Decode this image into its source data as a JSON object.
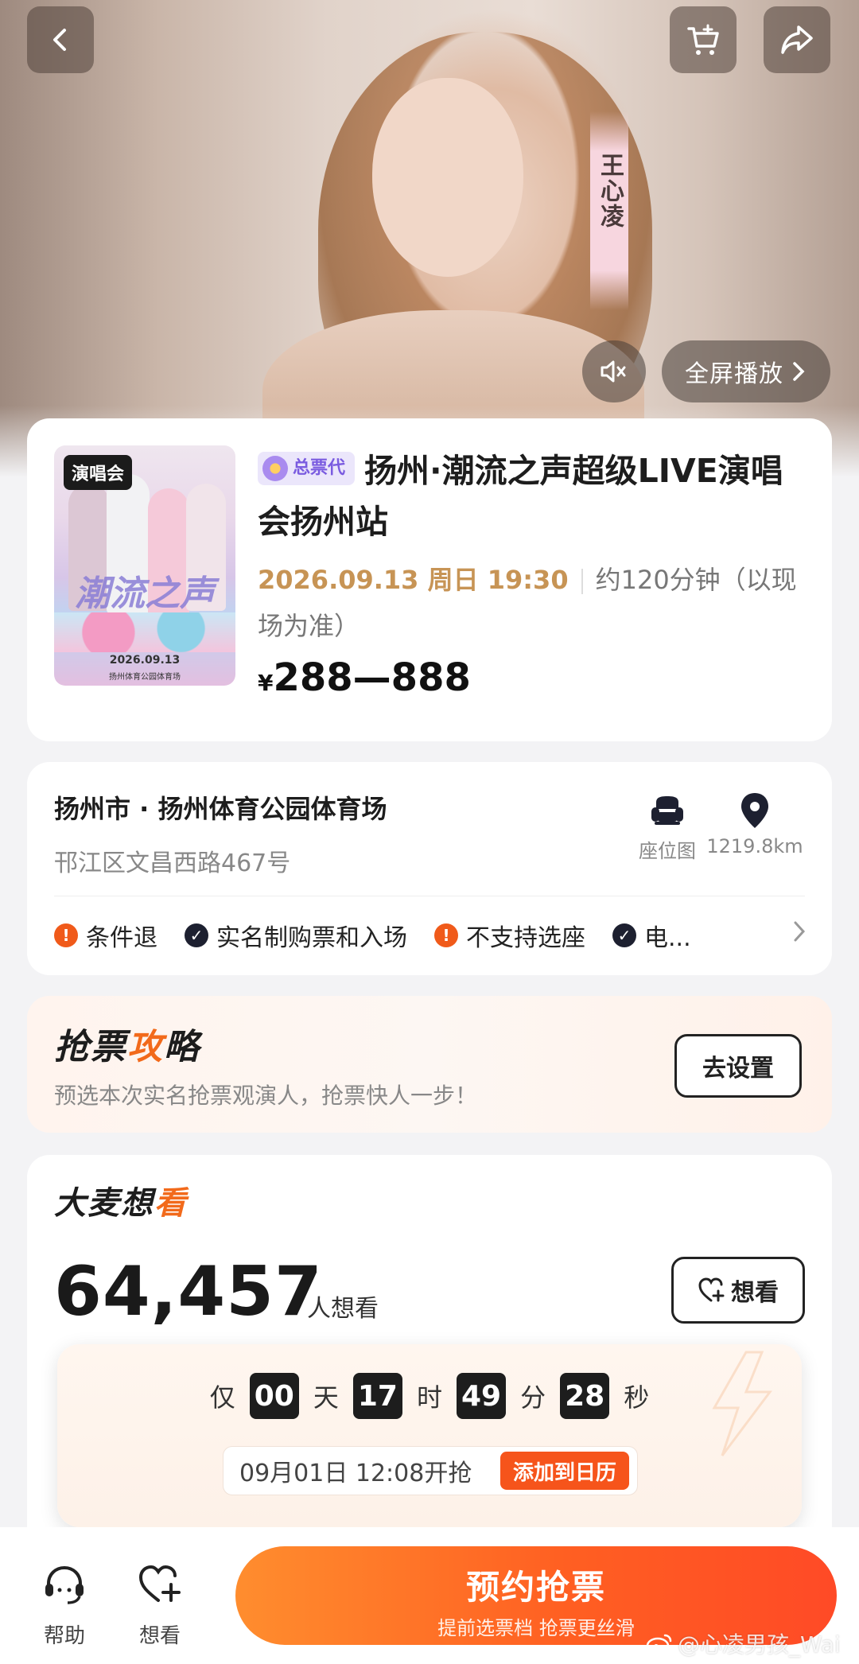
{
  "video": {
    "name_tag": "王心凌",
    "fullscreen_label": "全屏播放"
  },
  "event": {
    "poster_tag": "演唱会",
    "poster_title": "潮流之声",
    "poster_date": "2026.09.13",
    "poster_venue": "扬州体育公园体育场",
    "agent_badge": "总票代",
    "title": "扬州·潮流之声超级LIVE演唱会扬州站",
    "datetime": "2026.09.13 周日 19:30",
    "duration": "约120分钟（以现场为准）",
    "price_currency": "¥",
    "price_range": "288—888"
  },
  "venue": {
    "name": "扬州市 · 扬州体育公园体育场",
    "address": "邗江区文昌西路467号",
    "seat_map_label": "座位图",
    "distance": "1219.8km",
    "policies": [
      {
        "label": "条件退",
        "type": "warn"
      },
      {
        "label": "实名制购票和入场",
        "type": "ok"
      },
      {
        "label": "不支持选座",
        "type": "warn"
      },
      {
        "label": "电...",
        "type": "ok"
      }
    ]
  },
  "strategy": {
    "title_a": "抢票",
    "title_b": "攻",
    "title_c": "略",
    "subtitle": "预选本次实名抢票观演人，抢票快人一步！",
    "button": "去设置"
  },
  "want": {
    "title_a": "大麦想",
    "title_b": "看",
    "count": "64,457",
    "count_unit": "人想看",
    "button": "想看"
  },
  "countdown": {
    "prefix": "仅",
    "days": "00",
    "days_unit": "天",
    "hours": "17",
    "hours_unit": "时",
    "minutes": "49",
    "minutes_unit": "分",
    "seconds": "28",
    "seconds_unit": "秒",
    "open_time": "09月01日 12:08开抢",
    "calendar_button": "添加到日历"
  },
  "bottom": {
    "help_label": "帮助",
    "want_label": "想看",
    "buy_main": "预约抢票",
    "buy_sub": "提前选票档 抢票更丝滑"
  },
  "watermark": "@心凌男孩_Wai",
  "colors": {
    "accent": "#f6541b",
    "date": "#c79455",
    "agent_badge": "#7a5be0"
  }
}
